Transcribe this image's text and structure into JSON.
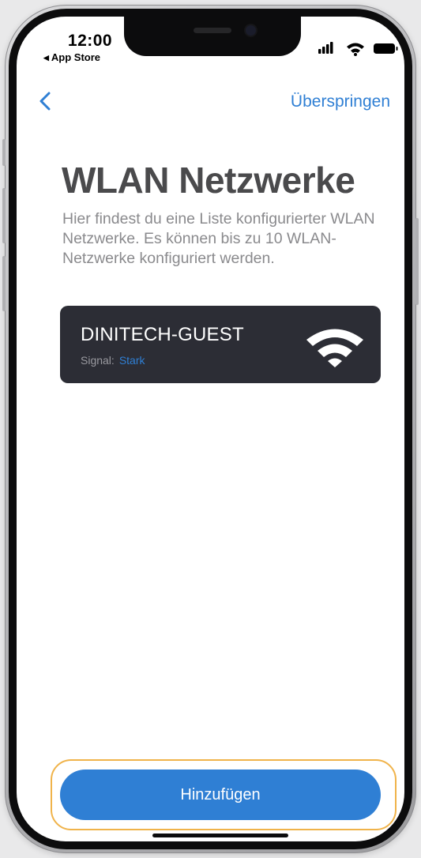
{
  "status_bar": {
    "time": "12:00",
    "back_app": "App Store",
    "icons": [
      "cellular-signal-icon",
      "wifi-icon",
      "battery-icon"
    ]
  },
  "nav": {
    "back_icon": "chevron-left-icon",
    "skip_label": "Überspringen"
  },
  "page": {
    "title": "WLAN Netzwerke",
    "description": "Hier findest  du eine Liste konfigurierter WLAN Netzwerke. Es können bis zu 10 WLAN-Netzwerke konfiguriert werden."
  },
  "networks": [
    {
      "ssid": "DINITECH-GUEST",
      "signal_label": "Signal:",
      "signal_value": "Stark",
      "icon": "wifi-strong-icon"
    }
  ],
  "footer": {
    "add_button_label": "Hinzufügen"
  },
  "colors": {
    "accent": "#2f7fd4",
    "card_background": "#2c2d35",
    "highlight_outline": "#f0b34a"
  }
}
